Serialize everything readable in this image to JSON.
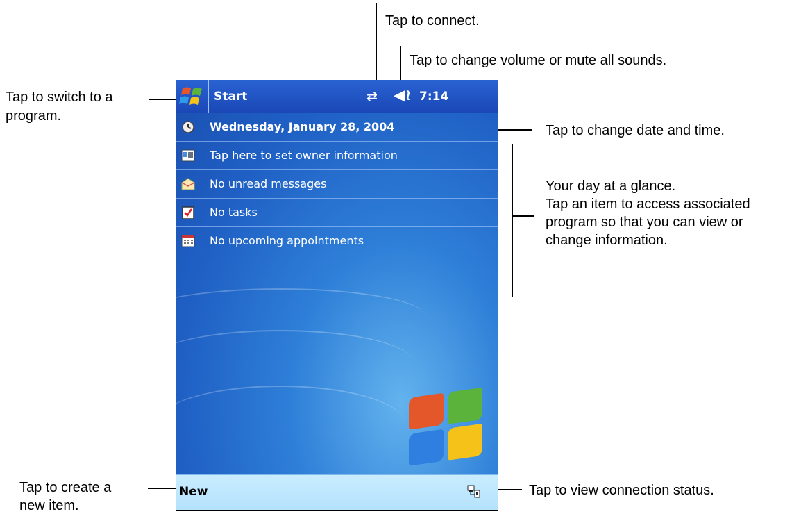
{
  "callouts": {
    "connect": "Tap to connect.",
    "volume": "Tap to change volume or mute all sounds.",
    "switch_line1": "Tap to switch to a",
    "switch_line2": "program.",
    "datetime": "Tap to change date and time.",
    "glance_line1": "Your day at a glance.",
    "glance_line2": "Tap an item to access associated",
    "glance_line3": "program so that you can view or",
    "glance_line4": "change information.",
    "create_line1": "Tap to create a",
    "create_line2": "new item.",
    "connection_status": "Tap to view connection status."
  },
  "taskbar": {
    "start_label": "Start",
    "clock": "7:14",
    "icons": {
      "start": "windows-flag-icon",
      "connect": "connectivity-arrows-icon",
      "volume": "speaker-icon"
    }
  },
  "today": {
    "rows": [
      {
        "label": "Wednesday, January 28, 2004",
        "icon": "clock-icon"
      },
      {
        "label": "Tap here to set owner information",
        "icon": "contact-card-icon"
      },
      {
        "label": "No unread messages",
        "icon": "envelope-icon"
      },
      {
        "label": "No tasks",
        "icon": "task-checkbox-icon"
      },
      {
        "label": "No upcoming appointments",
        "icon": "calendar-icon"
      }
    ]
  },
  "menubar": {
    "new_label": "New",
    "connection_icon": "connection-status-icon"
  },
  "colors": {
    "taskbar": "#1f4fbf",
    "background": "#2e7fd8",
    "menubar": "#c9ecff"
  }
}
